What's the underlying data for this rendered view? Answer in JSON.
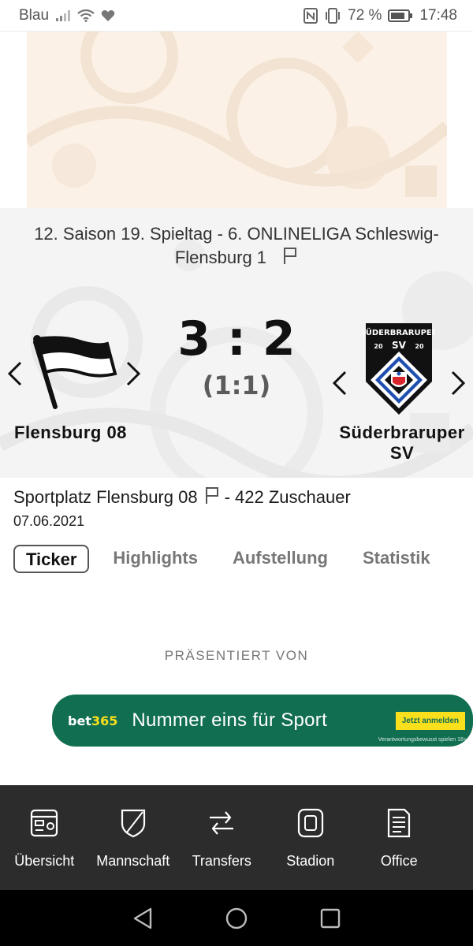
{
  "status_bar": {
    "carrier": "Blau",
    "battery": "72 %",
    "time": "17:48"
  },
  "match": {
    "league_line": "12. Saison 19. Spieltag - 6. ONLINELIGA Schleswig-Flensburg 1",
    "home_team": "Flensburg 08",
    "away_team": "Süderbraruper SV",
    "score": "3 : 2",
    "halftime": "(1:1)",
    "away_crest": {
      "text_top": "SÜDERBRARUPER",
      "year_left": "20",
      "sv": "SV",
      "year_right": "20"
    }
  },
  "venue": {
    "name": "Sportplatz Flensburg 08",
    "attendance": "- 422 Zuschauer",
    "date": "07.06.2021"
  },
  "tabs": [
    {
      "label": "Ticker",
      "active": true
    },
    {
      "label": "Highlights",
      "active": false
    },
    {
      "label": "Aufstellung",
      "active": false
    },
    {
      "label": "Statistik",
      "active": false
    }
  ],
  "presented_by": "PRÄSENTIERT VON",
  "ad": {
    "logo_a": "bet",
    "logo_b": "365",
    "title": "Nummer eins für Sport",
    "button": "Jetzt anmelden",
    "small": "Verantwortungsbewusst spielen  18+",
    "color": "#126e51",
    "accent": "#f9df1c"
  },
  "bottom_nav": [
    {
      "label": "Übersicht",
      "icon": "overview-icon"
    },
    {
      "label": "Mannschaft",
      "icon": "shield-icon"
    },
    {
      "label": "Transfers",
      "icon": "transfers-icon"
    },
    {
      "label": "Stadion",
      "icon": "stadium-icon"
    },
    {
      "label": "Office",
      "icon": "document-icon"
    }
  ]
}
